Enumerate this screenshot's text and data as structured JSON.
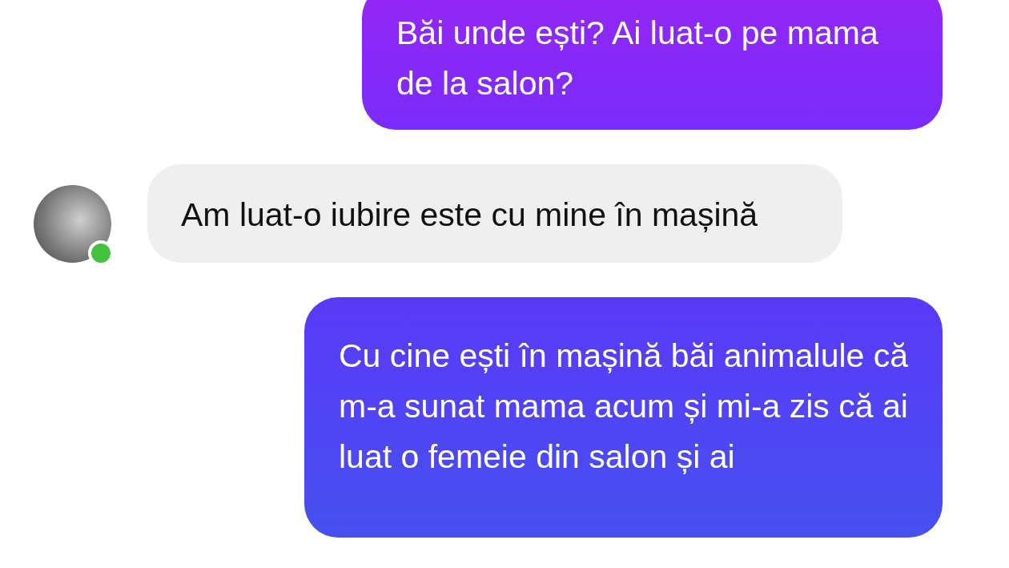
{
  "messages": [
    {
      "kind": "sent",
      "text": "Băi unde ești? Ai luat-o pe mama de la salon?"
    },
    {
      "kind": "received",
      "text": "Am luat-o iubire este cu mine în mașină",
      "online": true
    },
    {
      "kind": "sent",
      "text": "Cu cine ești în mașină băi animalule că m-a sunat mama acum și mi-a zis că ai luat o femeie din salon și ai"
    }
  ]
}
